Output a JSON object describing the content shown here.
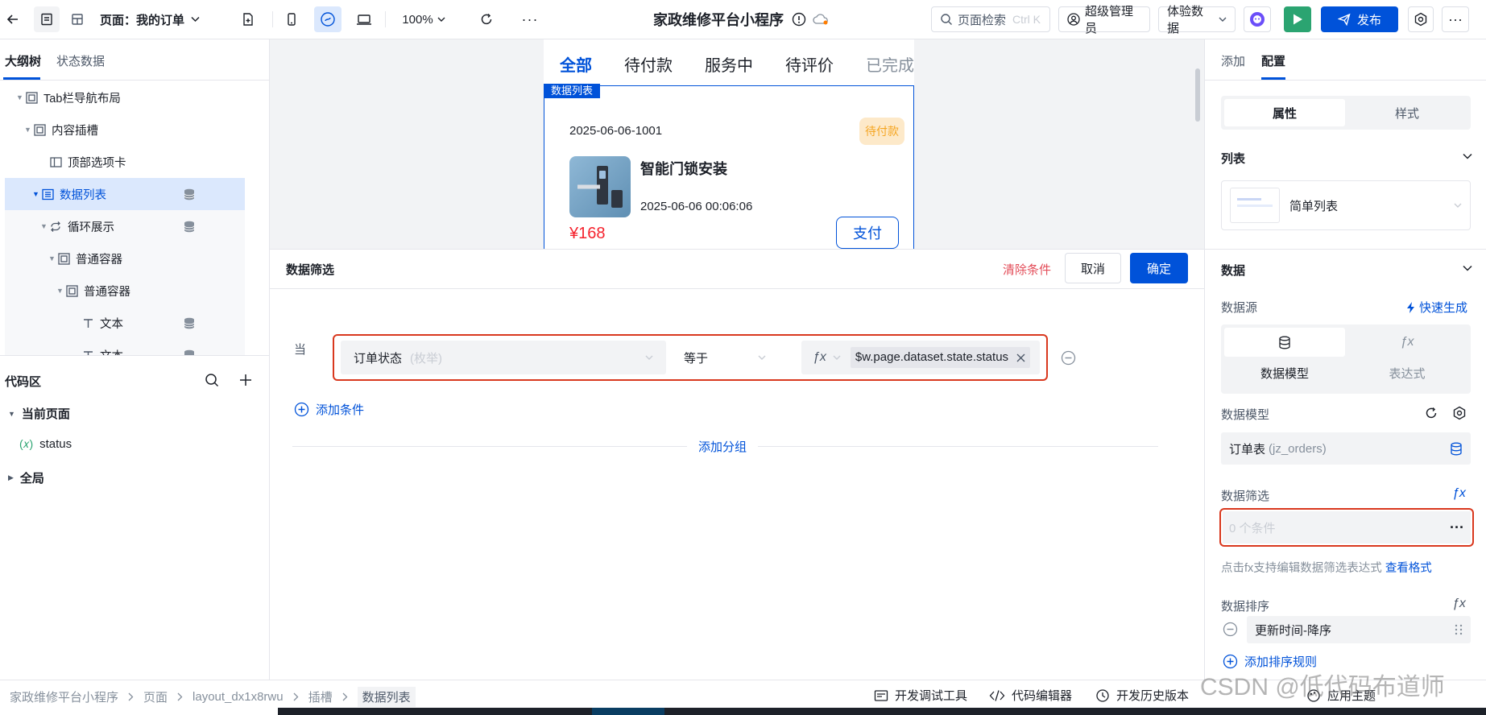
{
  "topbar": {
    "page_label": "页面：我的订单",
    "zoom": "100%",
    "more": "···",
    "app_title": "家政维修平台小程序",
    "search_placeholder": "页面检索",
    "search_shortcut": "Ctrl K",
    "admin_label": "超级管理员",
    "data_mode_label": "体验数据",
    "publish_label": "发布"
  },
  "left": {
    "tabs": [
      "大纲树",
      "状态数据"
    ],
    "tree": [
      {
        "label": "Tab栏导航布局"
      },
      {
        "label": "内容插槽"
      },
      {
        "label": "顶部选项卡"
      },
      {
        "label": "数据列表"
      },
      {
        "label": "循环展示"
      },
      {
        "label": "普通容器"
      },
      {
        "label": "普通容器"
      },
      {
        "label": "文本"
      },
      {
        "label": "文本"
      }
    ],
    "code_area_title": "代码区",
    "current_page_label": "当前页面",
    "var_prefix": "(𝑥)",
    "var_name": "status",
    "global_label": "全局"
  },
  "preview": {
    "tabs": [
      "全部",
      "待付款",
      "服务中",
      "待评价",
      "已完成"
    ],
    "list_tag": "数据列表",
    "order_no": "2025-06-06-1001",
    "status_badge": "待付款",
    "product_name": "智能门锁安装",
    "order_time": "2025-06-06 00:06:06",
    "price": "¥168",
    "pay_button": "支付"
  },
  "filter": {
    "title": "数据筛选",
    "clear_label": "清除条件",
    "cancel_label": "取消",
    "confirm_label": "确定",
    "when_label": "当",
    "field_label": "订单状态",
    "field_type": "(枚举)",
    "operator": "等于",
    "fx_label": "ƒx",
    "expression": "$w.page.dataset.state.status",
    "add_condition": "添加条件",
    "add_group": "添加分组"
  },
  "right": {
    "tabs": [
      "添加",
      "配置"
    ],
    "seg": [
      "属性",
      "样式"
    ],
    "list_section": "列表",
    "list_type": "简单列表",
    "data_section": "数据",
    "source_label": "数据源",
    "quick_gen": "快速生成",
    "source_opts": [
      "数据模型",
      "表达式"
    ],
    "model_label": "数据模型",
    "model_value": "订单表",
    "model_code": "(jz_orders)",
    "filter_label": "数据筛选",
    "filter_value": "0 个条件",
    "filter_hint": "点击fx支持编辑数据筛选表达式",
    "filter_hint_link": "查看格式",
    "sort_label": "数据排序",
    "sort_value": "更新时间-降序",
    "add_sort": "添加排序规则"
  },
  "bottom": {
    "breadcrumb": [
      "家政维修平台小程序",
      "页面",
      "layout_dx1x8rwu",
      "插槽",
      "数据列表"
    ],
    "debug_tools": "开发调试工具",
    "code_editor": "代码编辑器",
    "history": "开发历史版本",
    "apply_theme": "应用主题"
  },
  "watermark": "CSDN @低代码布道师",
  "colors": {
    "primary": "#0052d9",
    "danger": "#e34d59",
    "warning": "#f5a623",
    "price": "#f5222d",
    "selected_bg": "#dbe8fd"
  }
}
